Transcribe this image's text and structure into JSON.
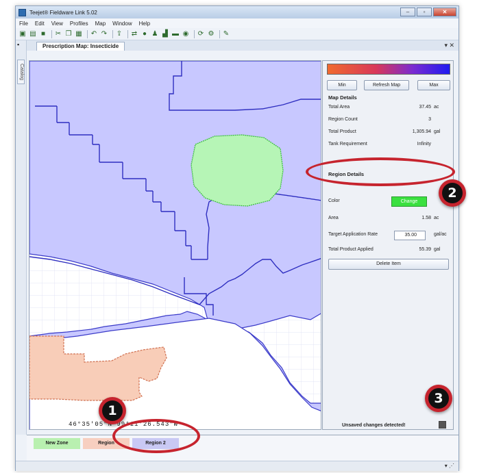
{
  "window": {
    "title": "Teejet® Fieldware Link 5.02",
    "buttons": [
      "–",
      "▫",
      "✕"
    ]
  },
  "menu": [
    "File",
    "Edit",
    "View",
    "Profiles",
    "Map",
    "Window",
    "Help"
  ],
  "toolbar_icons": [
    "new-icon",
    "open-icon",
    "save-icon",
    "cut-icon",
    "copy-icon",
    "paste-icon",
    "undo-icon",
    "redo-icon",
    "export-icon",
    "import-icon",
    "globe-icon",
    "user-icon",
    "chart-icon",
    "car-icon",
    "record-icon",
    "sync-icon",
    "settings-icon",
    "pencil-icon"
  ],
  "side_rail": {
    "label": "Catalog"
  },
  "document_tab": {
    "label": "Prescription Map: Insecticide",
    "controls": "▾ ✕"
  },
  "map": {
    "coordinates": "46°35'05\"N 99°11'26.543\"W",
    "colors": {
      "zone_blue": "#c8c8ff",
      "zone_green": "#b6f5b6",
      "zone_orange": "#f8cdb8",
      "grid": "#d8dcf2"
    }
  },
  "panel": {
    "buttons": {
      "min": "Min",
      "refresh": "Refresh Map",
      "max": "Max"
    },
    "map_details": {
      "heading": "Map Details",
      "rows": [
        {
          "label": "Total Area",
          "value": "37.45",
          "unit": "ac"
        },
        {
          "label": "Region Count",
          "value": "3",
          "unit": ""
        },
        {
          "label": "Total Product",
          "value": "1,305.94",
          "unit": "gal"
        },
        {
          "label": "Tank Requirement",
          "value": "Infinity",
          "unit": ""
        }
      ]
    },
    "region_details": {
      "heading": "Region Details",
      "color_label": "Color",
      "change_label": "Change",
      "area_label": "Area",
      "area_value": "1.58",
      "area_unit": "ac",
      "rate_label": "Target Application Rate",
      "rate_value": "35.00",
      "rate_unit": "gal/ac",
      "total_label": "Total Product Applied",
      "total_value": "55.39",
      "total_unit": "gal",
      "delete_label": "Delete Item"
    },
    "unsaved": "Unsaved changes detected!"
  },
  "zones": [
    {
      "label": "New Zone",
      "color": "#b9f0b0"
    },
    {
      "label": "Region",
      "color": "#f7cfc0"
    },
    {
      "label": "Region 2",
      "color": "#c9c9f4"
    }
  ],
  "callouts": [
    "1",
    "2",
    "3"
  ]
}
